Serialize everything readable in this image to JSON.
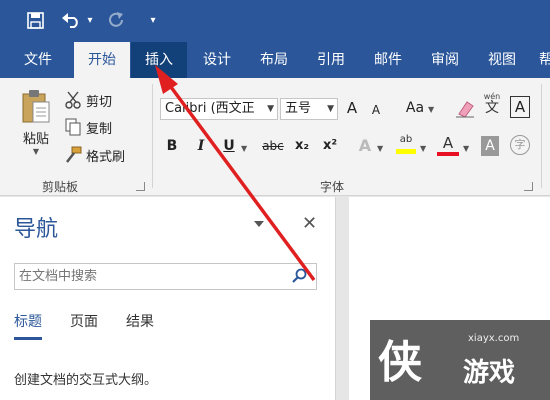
{
  "qat": {
    "save": "save-icon",
    "undo": "undo-icon",
    "undo_dd": "▾",
    "redo": "redo-icon",
    "customize": "▾"
  },
  "tabs": [
    "文件",
    "开始",
    "插入",
    "设计",
    "布局",
    "引用",
    "邮件",
    "审阅",
    "视图",
    "帮"
  ],
  "ribbon": {
    "clipboard": {
      "paste": "粘贴",
      "cut": "剪切",
      "copy": "复制",
      "format_painter": "格式刷",
      "label": "剪贴板"
    },
    "font": {
      "font_name": "Calibri (西文正",
      "font_size": "五号",
      "grow": "A",
      "shrink": "A",
      "case": "Aa",
      "bold": "B",
      "italic": "I",
      "underline": "U",
      "strike": "abc",
      "sub": "x₂",
      "sup": "x²",
      "effects": "A",
      "highlight": "ab",
      "color": "A",
      "shade": "A",
      "enclose": "字",
      "phonetic": "wén",
      "phonetic_char": "文",
      "border": "A",
      "label": "字体"
    }
  },
  "nav": {
    "title": "导航",
    "search_placeholder": "在文档中搜索",
    "tabs": [
      "标题",
      "页面",
      "结果"
    ],
    "description": "创建文档的交互式大纲。"
  },
  "watermark": {
    "url": "xiayx.com",
    "logo_char": "侠",
    "name": "游戏"
  },
  "colors": {
    "ribbon_blue": "#2b579a",
    "highlight_yellow": "#ffff00",
    "font_red": "#e81123",
    "arrow_red": "#e02020"
  }
}
